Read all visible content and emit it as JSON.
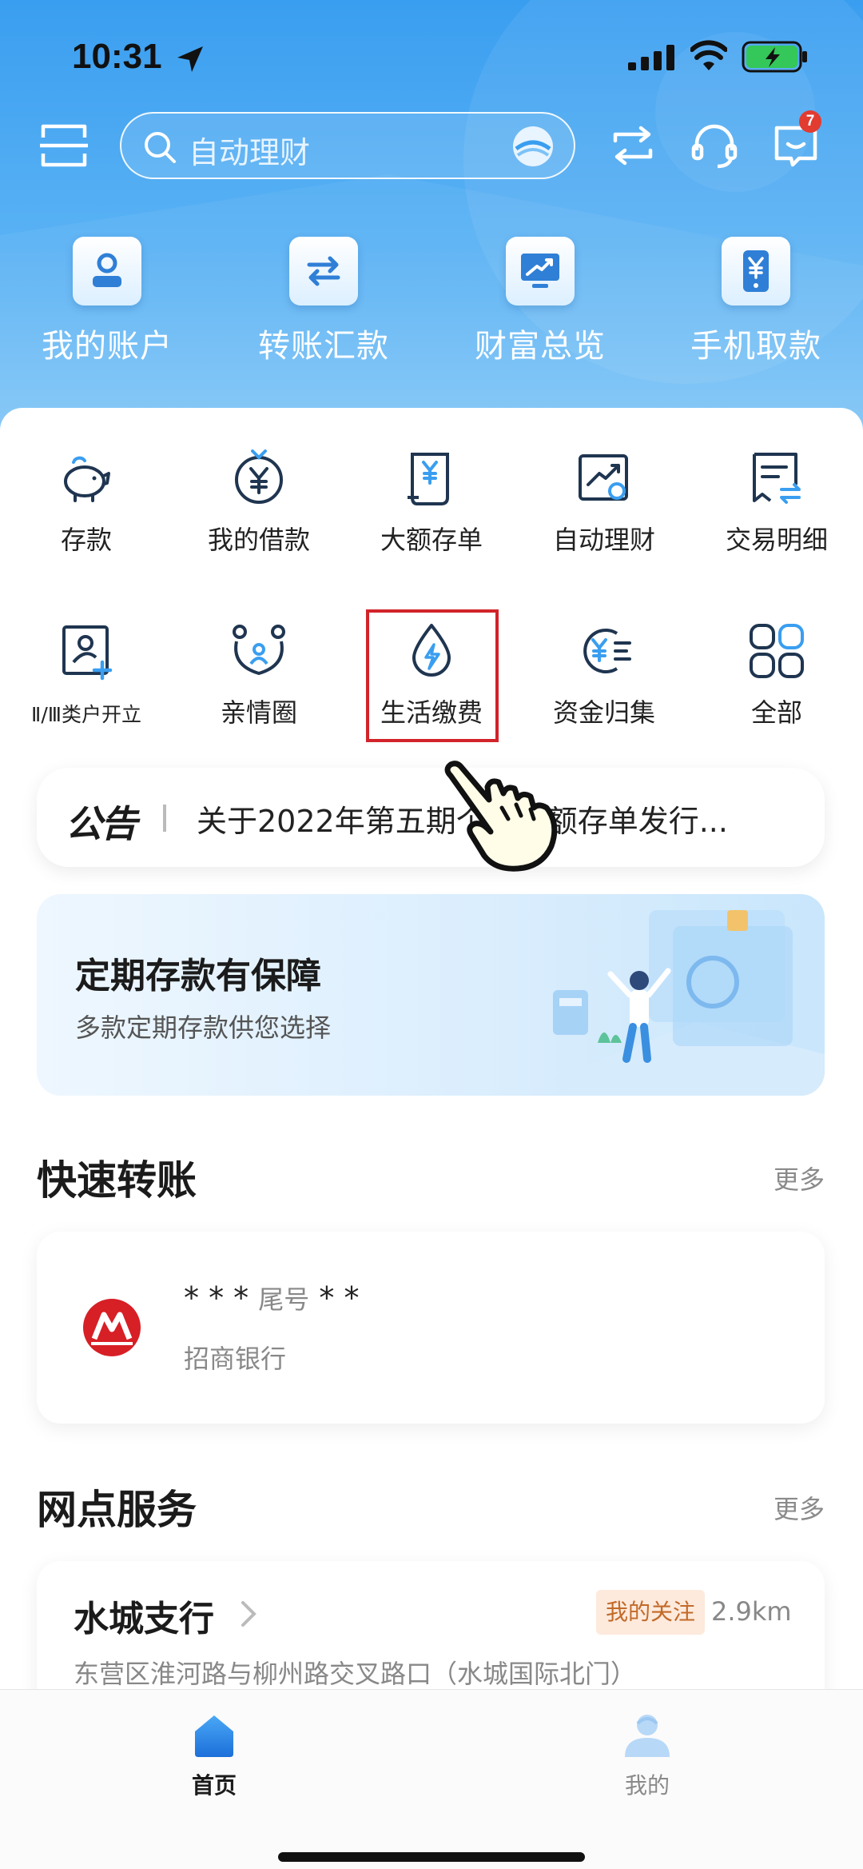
{
  "status_bar": {
    "time": "10:31"
  },
  "header": {
    "search_placeholder": "自动理财",
    "message_badge": "7",
    "quick_actions": [
      {
        "label": "我的账户",
        "icon": "account-icon"
      },
      {
        "label": "转账汇款",
        "icon": "transfer-icon"
      },
      {
        "label": "财富总览",
        "icon": "wealth-chart-icon"
      },
      {
        "label": "手机取款",
        "icon": "phone-withdraw-icon"
      }
    ]
  },
  "services": {
    "row1": [
      {
        "label": "存款",
        "icon": "piggy-bank-icon"
      },
      {
        "label": "我的借款",
        "icon": "loan-icon"
      },
      {
        "label": "大额存单",
        "icon": "certificate-icon"
      },
      {
        "label": "自动理财",
        "icon": "auto-finance-icon"
      },
      {
        "label": "交易明细",
        "icon": "transaction-detail-icon"
      }
    ],
    "row2": [
      {
        "label": "Ⅱ/Ⅲ类户开立",
        "icon": "open-account-icon"
      },
      {
        "label": "亲情圈",
        "icon": "family-circle-icon"
      },
      {
        "label": "生活缴费",
        "icon": "utility-payment-icon",
        "highlighted": true
      },
      {
        "label": "资金归集",
        "icon": "fund-collection-icon"
      },
      {
        "label": "全部",
        "icon": "all-services-icon"
      }
    ]
  },
  "notice": {
    "tag": "公告",
    "text": "关于2022年第五期个人大额存单发行..."
  },
  "banner": {
    "title": "定期存款有保障",
    "subtitle": "多款定期存款供您选择"
  },
  "quick_transfer": {
    "title": "快速转账",
    "more": "更多",
    "payee": {
      "name": "* * *",
      "tail_label": "尾号",
      "tail": "* *",
      "bank": "招商银行"
    }
  },
  "branch_service": {
    "title": "网点服务",
    "more": "更多",
    "branch": {
      "name": "水城支行",
      "tag": "我的关注",
      "distance": "2.9km",
      "address": "东营区淮河路与柳州路交叉路口（水城国际北门）"
    }
  },
  "tabbar": {
    "items": [
      {
        "label": "首页",
        "active": true,
        "icon": "home-icon"
      },
      {
        "label": "我的",
        "active": false,
        "icon": "profile-icon"
      }
    ]
  },
  "colors": {
    "primary": "#3a9ef0",
    "accent_icon": "#1f4a7a",
    "highlight": "#d2232a",
    "follow_tag_bg": "#fdeadc"
  }
}
